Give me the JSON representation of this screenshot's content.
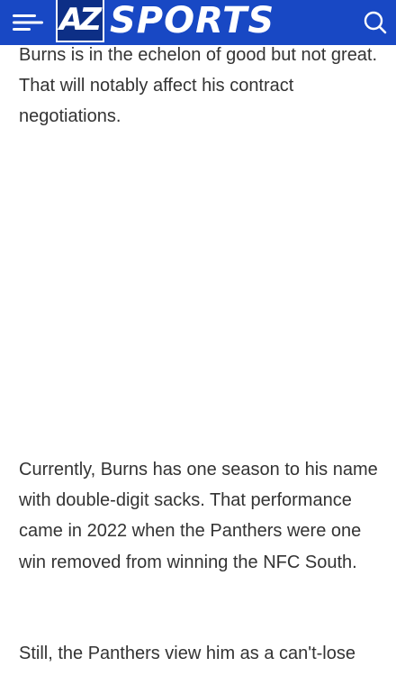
{
  "header": {
    "logo_badge": "AZ",
    "logo_text": "SPORTS",
    "brand_color": "#1848c4",
    "menu_icon": "menu-icon",
    "search_icon": "search-icon"
  },
  "article": {
    "paragraphs": [
      "Burns is in the echelon of good but not great. That will notably affect his contract negotiations.",
      "Currently, Burns has one season to his name with double-digit sacks. That performance came in 2022 when the Panthers were one win removed from winning the NFC South.",
      "Still, the Panthers view him as a can't-lose"
    ]
  }
}
